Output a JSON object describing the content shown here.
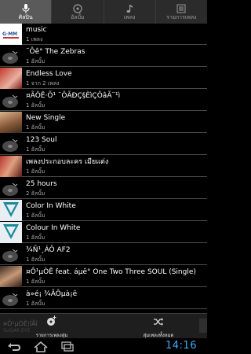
{
  "tabs": [
    {
      "label": "ศิลปิน",
      "icon": "microphone-icon"
    },
    {
      "label": "อัลบั้ม",
      "icon": "disc-icon"
    },
    {
      "label": "เพลง",
      "icon": "music-note-icon"
    },
    {
      "label": "รายการเพลง",
      "icon": "playlist-icon"
    }
  ],
  "rows": [
    {
      "title": "music",
      "subtitle": "1 เพลง"
    },
    {
      "title": "¨Ôê° The Zebras",
      "subtitle": "1 อัลบั้ม"
    },
    {
      "title": "Endless Love",
      "subtitle": "1 จาก 2 เพลง"
    },
    {
      "title": "¤ÃÔÊ·Õ¹ ¨ÔÃÐÇ§ÈìÇÔâÃ¨¹ì",
      "subtitle": "1 อัลบั้ม"
    },
    {
      "title": "New Single",
      "subtitle": "1 อัลบั้ม"
    },
    {
      "title": "123 Soul",
      "subtitle": "1 อัลบั้ม"
    },
    {
      "title": "เพลงประกอบละคร เมียแต่ง",
      "subtitle": "1 อัลบั้ม"
    },
    {
      "title": "25 hours",
      "subtitle": "2 อัลบั้ม"
    },
    {
      "title": "Color In White",
      "subtitle": "1 อัลบั้ม"
    },
    {
      "title": "Colour In White",
      "subtitle": "1 อัลบั้ม"
    },
    {
      "title": "¾Ñ¹¸ÁÔ AF2",
      "subtitle": "1 อัลบั้ม"
    },
    {
      "title": "¤Ô¹µÒÊ feat. áµê° One Two Three SOUL (Single)",
      "subtitle": "1 อัลบั้ม"
    },
    {
      "title": "à»é¡ ¾ÃÔµà¡ê",
      "subtitle": "1 อัลบั้ม"
    }
  ],
  "bottom_bar": {
    "now_playing_ghost": "¤Ô¹µÒÊ¦ÍÃì",
    "now_playing_ghost_sub": "SUGAR EYE",
    "playlist_label": "รายการเพลงสุ่ม",
    "shuffle_label": "สุ่มเพลงทั้งหมด"
  },
  "system": {
    "time": "14:16"
  },
  "colors": {
    "accent_blue": "#3fa9f5",
    "active_tab": "#5a5a5a"
  }
}
